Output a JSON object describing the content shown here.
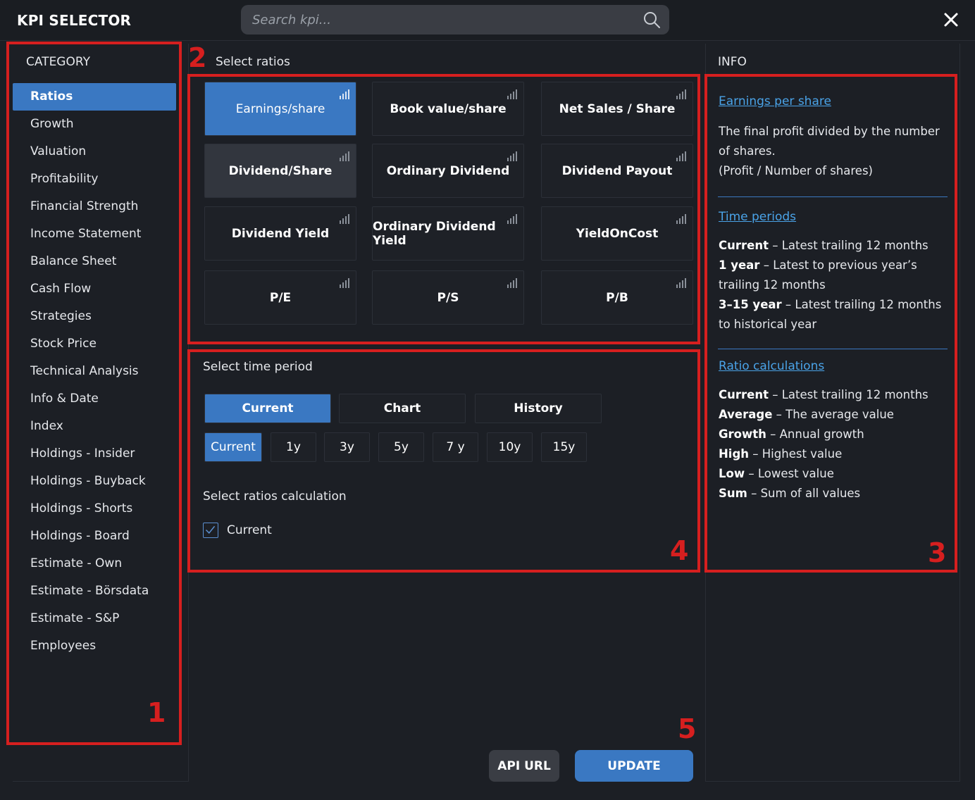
{
  "header": {
    "title": "KPI SELECTOR",
    "search_placeholder": "Search kpi...",
    "close_symbol": "✕"
  },
  "category": {
    "heading": "CATEGORY",
    "items": [
      {
        "label": "Ratios",
        "active": true
      },
      {
        "label": "Growth"
      },
      {
        "label": "Valuation"
      },
      {
        "label": "Profitability"
      },
      {
        "label": "Financial Strength"
      },
      {
        "label": "Income Statement"
      },
      {
        "label": "Balance Sheet"
      },
      {
        "label": "Cash Flow"
      },
      {
        "label": "Strategies"
      },
      {
        "label": "Stock Price"
      },
      {
        "label": "Technical Analysis"
      },
      {
        "label": "Info & Date"
      },
      {
        "label": "Index"
      },
      {
        "label": "Holdings - Insider"
      },
      {
        "label": "Holdings - Buyback"
      },
      {
        "label": "Holdings - Shorts"
      },
      {
        "label": "Holdings - Board"
      },
      {
        "label": "Estimate - Own"
      },
      {
        "label": "Estimate - Börsdata"
      },
      {
        "label": "Estimate - S&P"
      },
      {
        "label": "Employees"
      }
    ]
  },
  "ratios": {
    "heading": "Select ratios",
    "buttons": [
      {
        "label": "Earnings/share",
        "state": "selected"
      },
      {
        "label": "Book value/share"
      },
      {
        "label": "Net Sales / Share"
      },
      {
        "label": "Dividend/Share",
        "state": "hover"
      },
      {
        "label": "Ordinary Dividend"
      },
      {
        "label": "Dividend Payout"
      },
      {
        "label": "Dividend Yield"
      },
      {
        "label": "Ordinary Dividend Yield"
      },
      {
        "label": "YieldOnCost"
      },
      {
        "label": "P/E"
      },
      {
        "label": "P/S"
      },
      {
        "label": "P/B"
      }
    ]
  },
  "time_period": {
    "heading": "Select time period",
    "modes": [
      {
        "label": "Current",
        "active": true
      },
      {
        "label": "Chart"
      },
      {
        "label": "History"
      }
    ],
    "periods": [
      {
        "label": "Current",
        "active": true
      },
      {
        "label": "1y"
      },
      {
        "label": "3y"
      },
      {
        "label": "5y"
      },
      {
        "label": "7 y"
      },
      {
        "label": "10y"
      },
      {
        "label": "15y"
      }
    ],
    "calc_heading": "Select ratios calculation",
    "calc_option": {
      "label": "Current",
      "checked": true
    }
  },
  "info": {
    "heading": "INFO",
    "sections": [
      {
        "title": "Earnings per share",
        "lines": [
          {
            "text": "The final profit divided by the number of shares."
          },
          {
            "text": "(Profit / Number of shares)"
          }
        ]
      },
      {
        "title": "Time periods",
        "lines": [
          {
            "bold": "Current",
            "text": " – Latest trailing 12 months"
          },
          {
            "bold": "1 year",
            "text": " – Latest to previous year’s trailing 12 months"
          },
          {
            "bold": "3–15 year",
            "text": " – Latest trailing 12 months to historical year"
          }
        ]
      },
      {
        "title": "Ratio calculations",
        "lines": [
          {
            "bold": "Current",
            "text": " – Latest trailing 12 months"
          },
          {
            "bold": "Average",
            "text": " – The average value"
          },
          {
            "bold": "Growth",
            "text": " – Annual growth"
          },
          {
            "bold": "High",
            "text": " – Highest value"
          },
          {
            "bold": "Low",
            "text": " – Lowest value"
          },
          {
            "bold": "Sum",
            "text": " – Sum of all values"
          }
        ]
      }
    ]
  },
  "footer": {
    "api_label": "API URL",
    "update_label": "UPDATE"
  },
  "annotations": [
    "1",
    "2",
    "3",
    "4",
    "5"
  ],
  "colors": {
    "accent": "#3a78c2",
    "link": "#4aa3e8",
    "annotation": "#d61f1f",
    "background": "#1c1f25"
  }
}
